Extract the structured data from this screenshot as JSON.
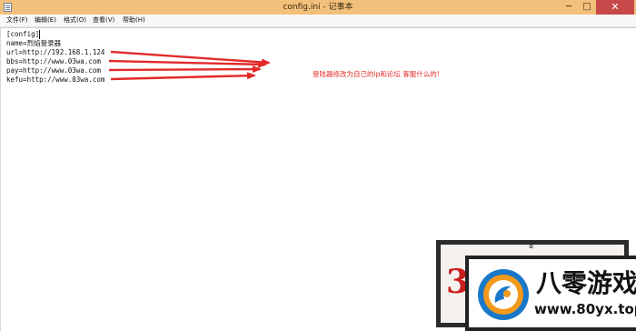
{
  "window": {
    "title": "config.ini - 记事本",
    "minimize": "─",
    "maximize": "□",
    "close": "✕"
  },
  "menu": [
    "文件(F)",
    "编辑(E)",
    "格式(O)",
    "查看(V)",
    "帮助(H)"
  ],
  "editor": {
    "lines": [
      "[config]",
      "name=烈焰登录器",
      "url=http://192.168.1.124",
      "bbs=http://www.03wa.com",
      "pay=http://www.03wa.com",
      "kefu=http://www.03wa.com"
    ]
  },
  "annotation": {
    "text": "登陆器修改为自己的ip和论坛 客服什么的!",
    "color": "#e32a2a"
  },
  "watermark": {
    "digit": "3",
    "brand": "八零游戏",
    "url": "www.80yx.top"
  },
  "icons": {
    "app": "notepad-icon",
    "logo": "brand-logo-icon"
  },
  "colors": {
    "titlebar": "#f2c07a",
    "close_button": "#c7494a",
    "arrow": "#e32a2a"
  }
}
